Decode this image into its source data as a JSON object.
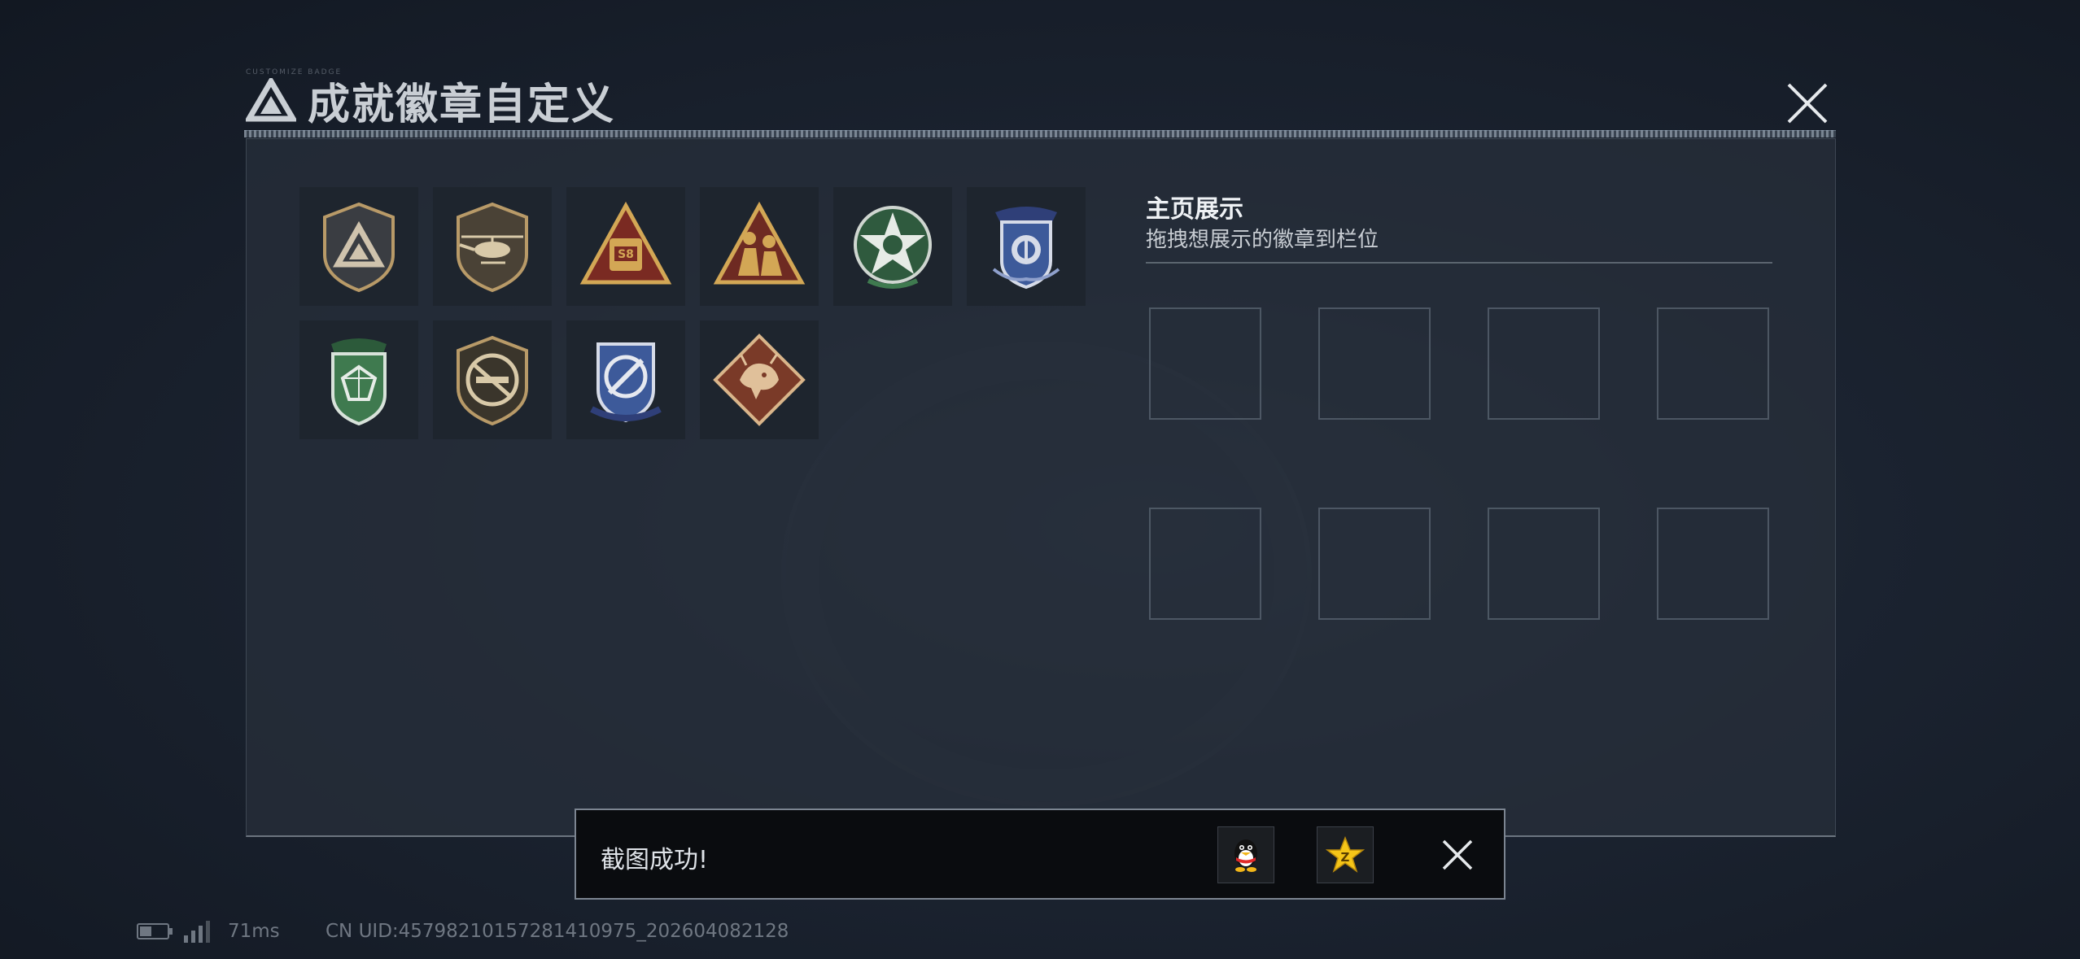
{
  "header": {
    "title": "成就徽章自定义",
    "tiny_text": "CUSTOMIZE BADGE"
  },
  "badges": [
    {
      "icon": "triangle-shield-badge-icon"
    },
    {
      "icon": "helicopter-badge-icon"
    },
    {
      "icon": "s8-vehicle-badge-icon"
    },
    {
      "icon": "soldier-triangle-badge-icon"
    },
    {
      "icon": "green-star-badge-icon"
    },
    {
      "icon": "blue-winged-shield-badge-icon"
    },
    {
      "icon": "green-gem-shield-badge-icon"
    },
    {
      "icon": "rifle-crest-badge-icon"
    },
    {
      "icon": "blue-crosshair-badge-icon"
    },
    {
      "icon": "dragon-diamond-badge-icon"
    }
  ],
  "showcase": {
    "title": "主页展示",
    "subtitle": "拖拽想展示的徽章到栏位"
  },
  "toast": {
    "message": "截图成功!",
    "share_qq_icon": "qq-penguin-icon",
    "share_qzone_icon": "qzone-star-icon"
  },
  "status": {
    "ping": "71ms",
    "uid": "CN UID:4579821015728141­0975_202604082128"
  },
  "colors": {
    "background": "#1b2330",
    "panel": "#262e3a",
    "accent_gold": "#c9a45a",
    "accent_green": "#3f7a4f",
    "accent_blue": "#3d5a9a",
    "toast_bg": "#0a0c0f"
  }
}
